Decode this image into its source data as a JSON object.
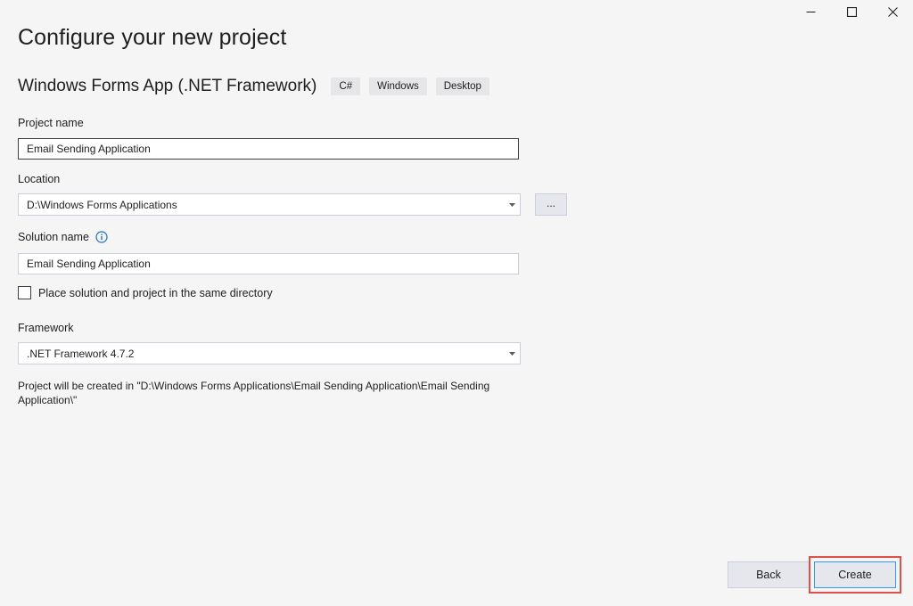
{
  "window": {
    "controls": [
      {
        "name": "minimize-icon"
      },
      {
        "name": "maximize-icon"
      },
      {
        "name": "close-icon"
      }
    ]
  },
  "page": {
    "title": "Configure your new project"
  },
  "template": {
    "name": "Windows Forms App (.NET Framework)",
    "tags": [
      "C#",
      "Windows",
      "Desktop"
    ]
  },
  "form": {
    "project_name": {
      "label": "Project name",
      "value": "Email Sending Application"
    },
    "location": {
      "label": "Location",
      "value": "D:\\Windows Forms Applications",
      "browse_label": "..."
    },
    "solution_name": {
      "label": "Solution name",
      "value": "Email Sending Application",
      "info_icon": "info-icon"
    },
    "same_directory": {
      "label": "Place solution and project in the same directory",
      "checked": false
    },
    "framework": {
      "label": "Framework",
      "value": ".NET Framework 4.7.2"
    },
    "path_note": "Project will be created in \"D:\\Windows Forms Applications\\Email Sending Application\\Email Sending Application\\\""
  },
  "footer": {
    "back_label": "Back",
    "create_label": "Create"
  },
  "colors": {
    "background": "#f5f5f6",
    "highlight": "#e0504a",
    "focus_border": "#3399ff",
    "info_icon": "#1e6fc4"
  }
}
